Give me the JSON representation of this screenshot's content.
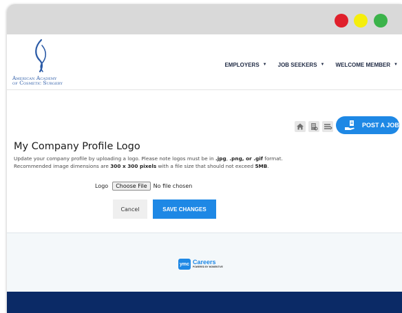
{
  "window": {
    "controls": [
      "close",
      "minimize",
      "maximize"
    ],
    "control_colors": {
      "close": "#e0202c",
      "minimize": "#f5ee0c",
      "maximize": "#3bb34a"
    }
  },
  "header": {
    "logo": {
      "line1": "American Academy",
      "line2": "of Cosmetic Surgery",
      "icon": "flame-logo-icon"
    },
    "nav": [
      {
        "label": "EMPLOYERS"
      },
      {
        "label": "JOB SEEKERS"
      },
      {
        "label": "WELCOME MEMBER"
      }
    ]
  },
  "toolbar": {
    "icons": [
      "home-icon",
      "report-icon",
      "stack-icon"
    ],
    "post_job_label": "POST A JOB"
  },
  "main": {
    "title": "My Company Profile Logo",
    "desc_line1_a": "Update your company profile by uploading a logo. Please note logos must be in ",
    "fmt_jpg": ".jpg",
    "sep1": ", ",
    "fmt_png": ".png",
    "sep2": ", or ",
    "fmt_gif": ".gif",
    "desc_line1_b": " format.",
    "desc_line2_a": "Recommended image dimensions are ",
    "dims": "300 x 300 pixels",
    "desc_line2_b": " with a file size that should not exceed ",
    "max_size": "5MB",
    "desc_line2_c": ".",
    "logo_label": "Logo",
    "choose_file_label": "Choose File",
    "file_status": "No file chosen",
    "cancel_label": "Cancel",
    "save_label": "SAVE CHANGES"
  },
  "footer": {
    "badge": "ymc",
    "brand": "Careers",
    "powered_by": "POWERED BY MOMENTIVE"
  },
  "colors": {
    "accent": "#1e88e5",
    "nav_text": "#1f2a44",
    "footer_bar": "#0b2a66",
    "logo_blue": "#2a5aa6"
  }
}
